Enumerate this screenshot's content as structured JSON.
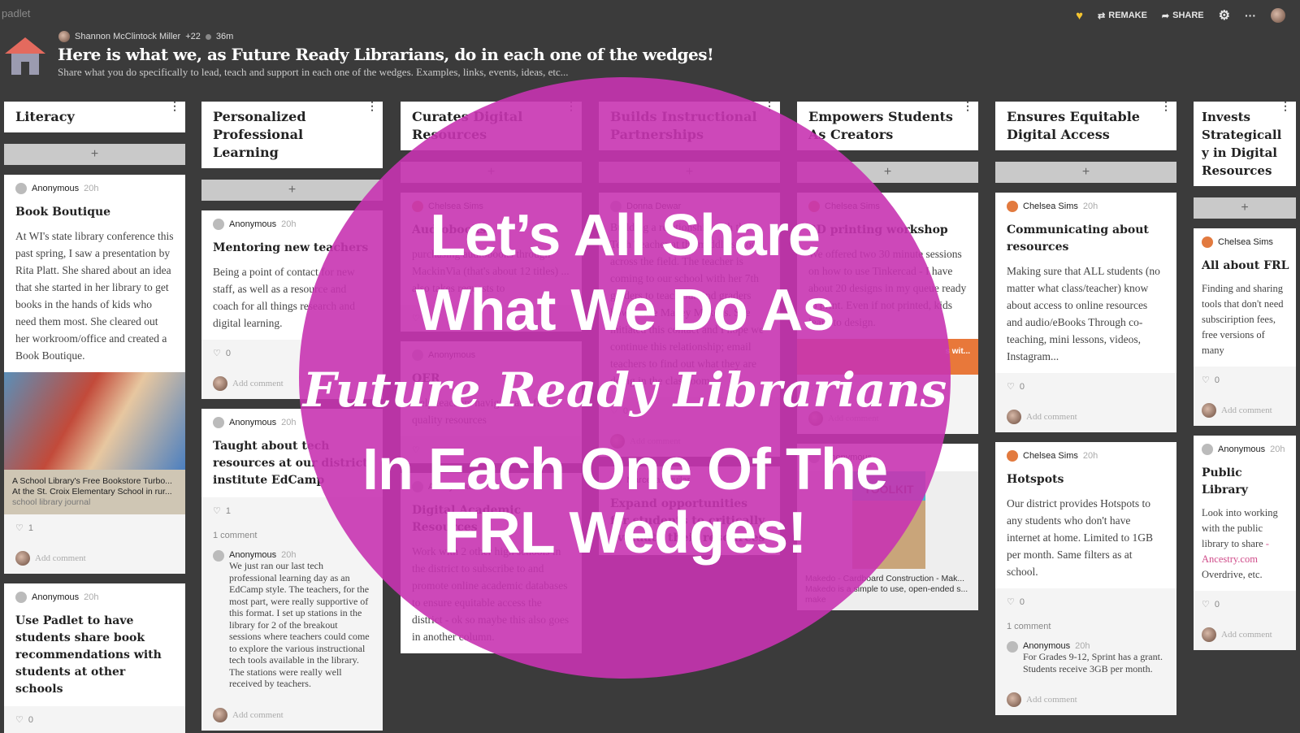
{
  "app": {
    "logo": "padlet",
    "remake": "REMAKE",
    "share": "SHARE"
  },
  "header": {
    "author": "Shannon McClintock Miller",
    "contributors": "+22",
    "age": "36m",
    "title": "Here is what we, as Future Ready Librarians, do in each one of the wedges!",
    "subtitle": "Share what you do specifically to lead, teach and support in each one of the wedges. Examples, links, events, ideas, etc..."
  },
  "columns": [
    {
      "title": "Literacy",
      "posts": [
        {
          "author": "Anonymous",
          "time": "20h",
          "title": "Book Boutique",
          "body": "At WI's state library conference this past spring, I saw a presentation by Rita Platt. She shared about an idea that she started in her library to get books in the hands of kids who need them most. She cleared out her workroom/office and created a Book Boutique.",
          "image": true,
          "preview": {
            "title": "A School Library's Free Bookstore Turbo...",
            "desc": "At the St. Croix Elementary School in rur...",
            "source": "school library journal"
          },
          "likes": "1",
          "add_comment": "Add comment"
        },
        {
          "author": "Anonymous",
          "time": "20h",
          "title": "Use Padlet to have students share book recommendations with students at other schools",
          "likes": "0"
        }
      ]
    },
    {
      "title": "Personalized Professional Learning",
      "posts": [
        {
          "author": "Anonymous",
          "time": "20h",
          "title": "Mentoring new teachers",
          "body": "Being a point of contact for new staff, as well as a resource and coach for all things research and digital learning.",
          "likes": "0",
          "add_comment": "Add comment"
        },
        {
          "author": "Anonymous",
          "time": "20h",
          "title": "Taught about tech resources at our district institute EdCamp",
          "likes": "1",
          "comment_count": "1 comment",
          "comments": [
            {
              "author": "Anonymous",
              "time": "20h",
              "text": "We just ran our last tech professional learning day as an EdCamp style. The teachers, for the most part, were really supportive of this format. I set up stations in the library for 2 of the breakout sessions where teachers could come to explore the various instructional tech tools available in the library. The stations were really well received by teachers."
            }
          ],
          "add_comment": "Add comment"
        }
      ]
    },
    {
      "title": "Curates Digital Resources",
      "posts": [
        {
          "author": "Chelsea Sims",
          "time": "",
          "title": "Audiobooks",
          "body": "purchasing audiobooks through MackinVia (that's about 12 titles) ... also takes requests to",
          "likes": ""
        },
        {
          "author": "Anonymous",
          "time": "",
          "title": "OER",
          "body": "Help teachers navigate and find quality resources",
          "likes": ""
        },
        {
          "author": "Anonymous",
          "time": "",
          "title": "Digital Academic Resources",
          "body": "Work with 2 other high schools in the district to subscribe to and promote online academic databases to ensure equitable access the district - ok so maybe this also goes in another column."
        }
      ]
    },
    {
      "title": "Builds Instructional Partnerships",
      "posts": [
        {
          "author": "Donna Dewar",
          "time": "",
          "title": "",
          "body": "Building a relationship with the Tech Teacher at the middle school across the field. The teacher is coming to our school with her 7th graders to teach our 2nd graders how to use Makey Makeys. She initiated this contact and I hope we continue this relationship; email teachers to find out what they are doing in the classroom.",
          "likes": "0",
          "add_comment": "Add comment"
        },
        {
          "author": "Marcella Aguilar",
          "time": "",
          "title": "Expand opportunities for students to critically evaluate their resources"
        }
      ]
    },
    {
      "title": "Empowers Students As Creators",
      "posts": [
        {
          "author": "Chelsea Sims",
          "time": "",
          "title": "3D printing workshop",
          "body": "We offered two 30 minute sessions on how to use Tinkercad - I have about 20 designs in my queue ready to print. Even if not printed, kids learn to design.",
          "orange": "s wit...",
          "likes": "",
          "add_comment": "Add comment"
        },
        {
          "author": "Anonymous",
          "time": "",
          "makedo": {
            "box": "TOOLKIT",
            "title": "Makedo - Cardboard Construction - Mak...",
            "desc": "Makedo is a simple to use, open-ended s...",
            "source": "make"
          }
        }
      ]
    },
    {
      "title": "Ensures Equitable Digital Access",
      "posts": [
        {
          "author": "Chelsea Sims",
          "time": "20h",
          "title": "Communicating about resources",
          "body": "Making sure that ALL students (no matter what class/teacher) know about access to online resources and audio/eBooks Through co-teaching, mini lessons, videos, Instagram...",
          "likes": "0",
          "add_comment": "Add comment"
        },
        {
          "author": "Chelsea Sims",
          "time": "20h",
          "title": "Hotspots",
          "body": "Our district provides Hotspots to any students who don't have internet at home. Limited to 1GB per month. Same filters as at school.",
          "likes": "0",
          "comment_count": "1 comment",
          "comments": [
            {
              "author": "Anonymous",
              "time": "20h",
              "text": "For Grades 9-12, Sprint has a grant. Students receive 3GB per month."
            }
          ],
          "add_comment": "Add comment"
        }
      ]
    },
    {
      "title": "Invests Strategically in Digital Resources",
      "posts": [
        {
          "author": "Chelsea Sims",
          "time": "",
          "title": "All about FRL",
          "body": "Finding and sharing tools that don't need subsciription fees, free versions of many",
          "likes": "0",
          "add_comment": "Add comment"
        },
        {
          "author": "Anonymous",
          "time": "20h",
          "title": "Public Library",
          "body": "Look into working with the public library to share",
          "link": "-Ancestry.com",
          "body2": "Overdrive, etc.",
          "likes": "0",
          "add_comment": "Add comment"
        }
      ]
    }
  ],
  "overlay": {
    "line1": "Let’s All Share",
    "line2": "What We Do As",
    "script": "Future Ready Librarians",
    "line3": "In Each One Of The",
    "line4": "FRL Wedges!",
    "color": "#c834b1"
  }
}
